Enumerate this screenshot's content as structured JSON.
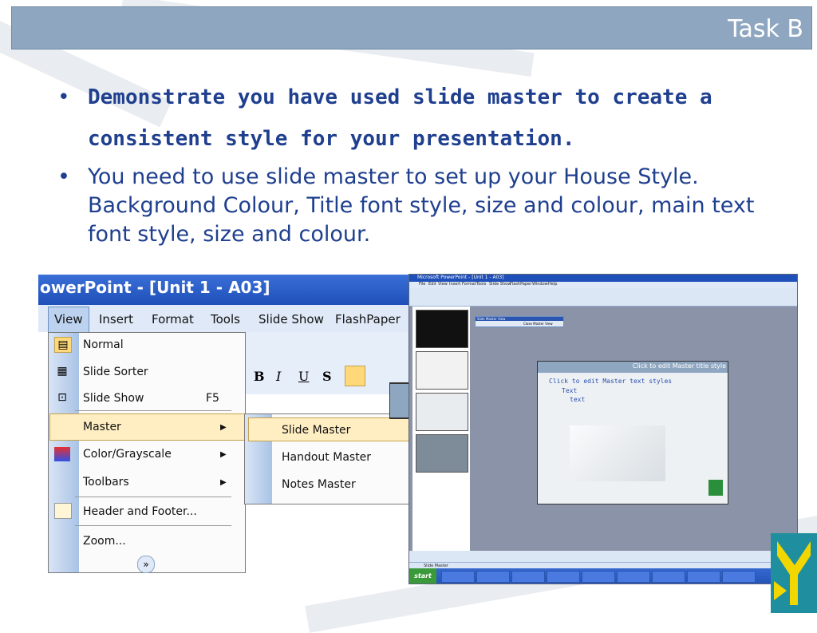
{
  "header": {
    "title": "Task B"
  },
  "bullets": {
    "marker": "•",
    "item1": "Demonstrate you have used slide master to create a consistent style for your presentation.",
    "item2": "You need to use slide master to set up your House Style.  Background Colour, Title font style, size and colour, main text font style, size and colour."
  },
  "left_shot": {
    "title": "owerPoint - [Unit 1 - A03]",
    "menu": [
      "View",
      "Insert",
      "Format",
      "Tools",
      "Slide Show",
      "FlashPaper"
    ],
    "items": [
      {
        "label": "Normal",
        "shortcut": ""
      },
      {
        "label": "Slide Sorter",
        "shortcut": ""
      },
      {
        "label": "Slide Show",
        "shortcut": "F5"
      },
      {
        "label": "Master",
        "shortcut": ""
      },
      {
        "label": "Color/Grayscale",
        "shortcut": ""
      },
      {
        "label": "Toolbars",
        "shortcut": ""
      },
      {
        "label": "Header and Footer...",
        "shortcut": ""
      },
      {
        "label": "Zoom...",
        "shortcut": ""
      }
    ],
    "submenu": [
      "Slide Master",
      "Handout Master",
      "Notes Master"
    ],
    "toolbar_buttons": [
      "B",
      "I",
      "U",
      "S"
    ]
  },
  "right_shot": {
    "title": "Microsoft PowerPoint - [Unit 1 - A03]",
    "menu": [
      "File",
      "Edit",
      "View",
      "Insert",
      "Format",
      "Tools",
      "Slide Show",
      "FlashPaper",
      "Window",
      "Help"
    ],
    "master_view_toolbar": "Slide Master View",
    "close_master_view": "Close Master View",
    "slide_title": "Click to edit Master title style",
    "text_levels": [
      "Click to edit Master text styles",
      "Text",
      "text"
    ],
    "start_label": "start",
    "status": "Slide Master"
  },
  "colors": {
    "title_bar": "#8ea6c0",
    "text_blue": "#1f3f8f",
    "highlight": "#ffeec2"
  }
}
